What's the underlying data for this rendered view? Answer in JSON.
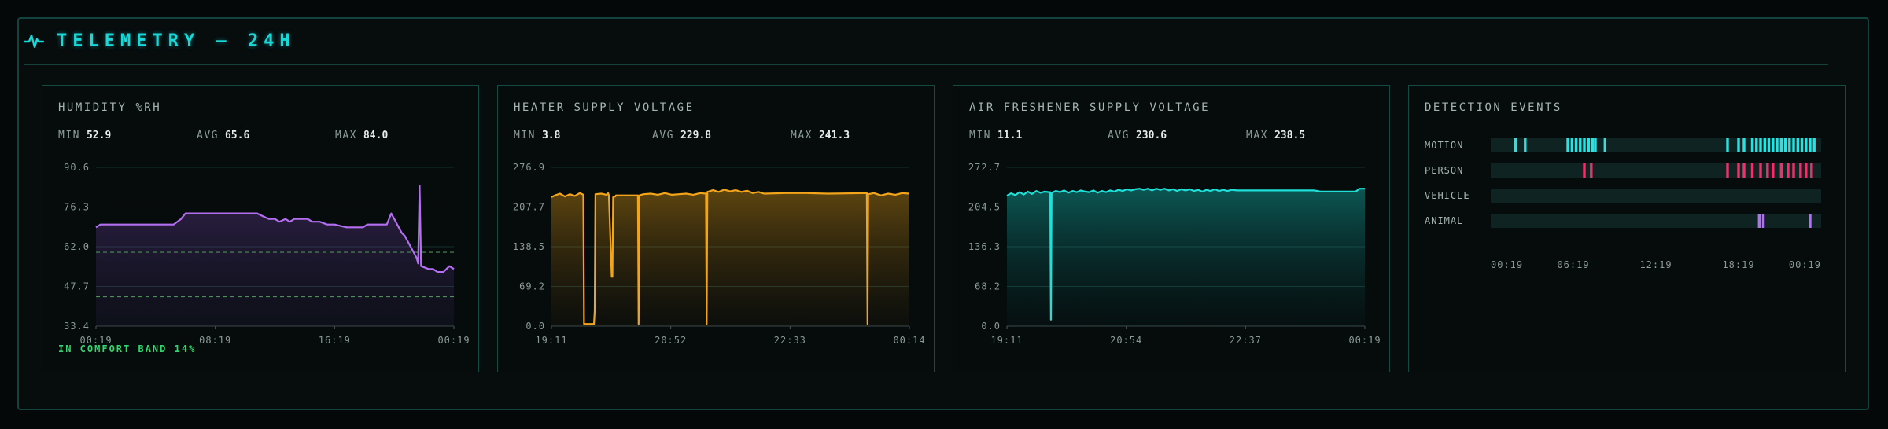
{
  "header": {
    "title": "TELEMETRY — 24H",
    "icon": "pulse-icon"
  },
  "colors": {
    "accent": "#18d8d8",
    "humidity": "#b46ef0",
    "heater": "#f2a51a",
    "freshener": "#1ee0d8",
    "motion": "#27e3e3",
    "person": "#f0306a",
    "animal": "#b070f0",
    "comfort_text": "#2fd86f",
    "band_line": "#4e8d58"
  },
  "humidity": {
    "title": "HUMIDITY %RH",
    "stats": [
      {
        "label": "MIN",
        "value": "52.9"
      },
      {
        "label": "AVG",
        "value": "65.6"
      },
      {
        "label": "MAX",
        "value": "84.0"
      }
    ],
    "footer": "IN COMFORT BAND 14%"
  },
  "heater": {
    "title": "HEATER SUPPLY VOLTAGE",
    "stats": [
      {
        "label": "MIN",
        "value": "3.8"
      },
      {
        "label": "AVG",
        "value": "229.8"
      },
      {
        "label": "MAX",
        "value": "241.3"
      }
    ]
  },
  "freshener": {
    "title": "AIR FRESHENER SUPPLY VOLTAGE",
    "stats": [
      {
        "label": "MIN",
        "value": "11.1"
      },
      {
        "label": "AVG",
        "value": "230.6"
      },
      {
        "label": "MAX",
        "value": "238.5"
      }
    ]
  },
  "detection": {
    "title": "DETECTION EVENTS"
  },
  "chart_data": [
    {
      "type": "line",
      "title": "HUMIDITY %RH",
      "ylim": [
        33.4,
        90.6
      ],
      "y_ticks": [
        "90.6",
        "76.3",
        "62.0",
        "47.7",
        "33.4"
      ],
      "x_ticks": [
        "00:19",
        "08:19",
        "16:19",
        "00:19"
      ],
      "xlim_hours": [
        0,
        24
      ],
      "comfort_band": [
        44,
        60
      ],
      "grid": true,
      "series": [
        {
          "x": [
            0,
            0.3,
            5.2,
            5.7,
            6.0,
            10.8,
            11.2,
            11.6,
            12.0,
            12.3,
            12.7,
            13.0,
            13.3,
            13.8,
            14.2,
            14.5,
            15.0,
            15.5,
            16.0,
            16.8,
            17.2,
            17.5,
            17.9,
            18.2,
            18.5,
            19.2,
            19.5,
            19.8,
            20.0,
            20.3,
            20.5,
            20.7,
            20.9,
            21.1,
            21.3,
            21.5,
            21.6,
            21.7,
            21.8,
            22.3,
            22.6,
            22.9,
            23.3,
            23.5,
            23.7,
            24.0
          ],
          "y": [
            69,
            70,
            70,
            72,
            74,
            74,
            73,
            72,
            72,
            71,
            72,
            71,
            72,
            72,
            72,
            71,
            71,
            70,
            70,
            69,
            69,
            69,
            69,
            70,
            70,
            70,
            70,
            74,
            72,
            69,
            67,
            66,
            64,
            62,
            60,
            58,
            56,
            84,
            55,
            54,
            54,
            52.9,
            52.9,
            54,
            55,
            54
          ]
        }
      ]
    },
    {
      "type": "line",
      "title": "HEATER SUPPLY VOLTAGE",
      "ylim": [
        0,
        276.9
      ],
      "y_ticks": [
        "276.9",
        "207.7",
        "138.5",
        "69.2",
        "0.0"
      ],
      "x_ticks": [
        "19:11",
        "20:52",
        "22:33",
        "00:14"
      ],
      "xlim_hours": [
        0,
        5.05
      ],
      "grid": true,
      "series": [
        {
          "x": [
            0,
            0.05,
            0.12,
            0.19,
            0.26,
            0.33,
            0.4,
            0.45,
            0.46,
            0.47,
            0.6,
            0.61,
            0.62,
            0.7,
            0.78,
            0.8,
            0.81,
            0.85,
            0.86,
            0.87,
            0.9,
            0.91,
            1.22,
            1.23,
            1.24,
            1.3,
            1.4,
            1.5,
            1.6,
            1.7,
            1.8,
            1.9,
            2.0,
            2.1,
            2.18,
            2.19,
            2.2,
            2.28,
            2.36,
            2.44,
            2.52,
            2.6,
            2.68,
            2.76,
            2.84,
            2.92,
            3.0,
            3.3,
            3.6,
            3.9,
            4.45,
            4.46,
            4.47,
            4.55,
            4.65,
            4.75,
            4.85,
            4.95,
            5.05
          ],
          "y": [
            225,
            228,
            231,
            226,
            230,
            227,
            232,
            229,
            3.8,
            3.8,
            3.8,
            27,
            230,
            231,
            229,
            232,
            228,
            86,
            86,
            225,
            226,
            228,
            228,
            3.8,
            228,
            230,
            231,
            229,
            232,
            229,
            230,
            231,
            229,
            232,
            231,
            3.8,
            234,
            237,
            234,
            238,
            235,
            237,
            234,
            236,
            232,
            234,
            231,
            232,
            232,
            231,
            232,
            3.8,
            230,
            232,
            228,
            231,
            229,
            232,
            231
          ]
        }
      ]
    },
    {
      "type": "line",
      "title": "AIR FRESHENER SUPPLY VOLTAGE",
      "ylim": [
        0,
        272.7
      ],
      "y_ticks": [
        "272.7",
        "204.5",
        "136.3",
        "68.2",
        "0.0"
      ],
      "x_ticks": [
        "19:11",
        "20:54",
        "22:37",
        "00:19"
      ],
      "xlim_hours": [
        0,
        5.13
      ],
      "grid": true,
      "series": [
        {
          "x": [
            0,
            0.06,
            0.12,
            0.18,
            0.24,
            0.3,
            0.36,
            0.42,
            0.48,
            0.54,
            0.6,
            0.62,
            0.63,
            0.64,
            0.7,
            0.76,
            0.82,
            0.88,
            0.94,
            1.0,
            1.06,
            1.12,
            1.18,
            1.24,
            1.3,
            1.36,
            1.42,
            1.48,
            1.54,
            1.6,
            1.66,
            1.72,
            1.78,
            1.84,
            1.9,
            1.96,
            2.02,
            2.08,
            2.14,
            2.2,
            2.26,
            2.32,
            2.38,
            2.44,
            2.5,
            2.56,
            2.62,
            2.68,
            2.74,
            2.8,
            2.86,
            2.92,
            2.98,
            3.04,
            3.1,
            3.16,
            3.22,
            3.3,
            4.4,
            4.45,
            4.5,
            5.0,
            5.05,
            5.13
          ],
          "y": [
            224,
            228,
            225,
            230,
            226,
            231,
            227,
            232,
            229,
            231,
            230,
            230,
            11.1,
            229,
            232,
            230,
            233,
            229,
            232,
            230,
            233,
            231,
            230,
            233,
            229,
            232,
            230,
            233,
            231,
            234,
            232,
            235,
            233,
            235,
            236,
            234,
            236,
            233,
            236,
            234,
            236,
            233,
            235,
            232,
            235,
            233,
            235,
            232,
            234,
            231,
            234,
            232,
            235,
            232,
            234,
            232,
            234,
            233,
            233,
            232,
            231,
            231,
            236,
            236
          ]
        }
      ]
    },
    {
      "type": "event-timeline",
      "title": "DETECTION EVENTS",
      "categories": [
        "MOTION",
        "PERSON",
        "VEHICLE",
        "ANIMAL"
      ],
      "x_ticks": [
        "00:19",
        "06:19",
        "12:19",
        "18:19",
        "00:19"
      ],
      "xlim_hours": [
        0,
        24
      ],
      "events": {
        "MOTION": [
          1.8,
          2.5,
          5.6,
          5.9,
          6.2,
          6.5,
          6.8,
          7.1,
          7.4,
          7.6,
          8.3,
          17.2,
          18.0,
          18.4,
          19.0,
          19.3,
          19.6,
          19.9,
          20.2,
          20.5,
          20.8,
          21.1,
          21.4,
          21.7,
          22.0,
          22.3,
          22.6,
          22.9,
          23.2,
          23.5
        ],
        "PERSON": [
          6.8,
          7.3,
          17.2,
          18.0,
          18.4,
          19.0,
          19.6,
          20.1,
          20.5,
          21.1,
          21.6,
          22.0,
          22.5,
          22.9,
          23.3
        ],
        "VEHICLE": [],
        "ANIMAL": [
          19.5,
          19.8,
          23.2
        ]
      }
    }
  ]
}
